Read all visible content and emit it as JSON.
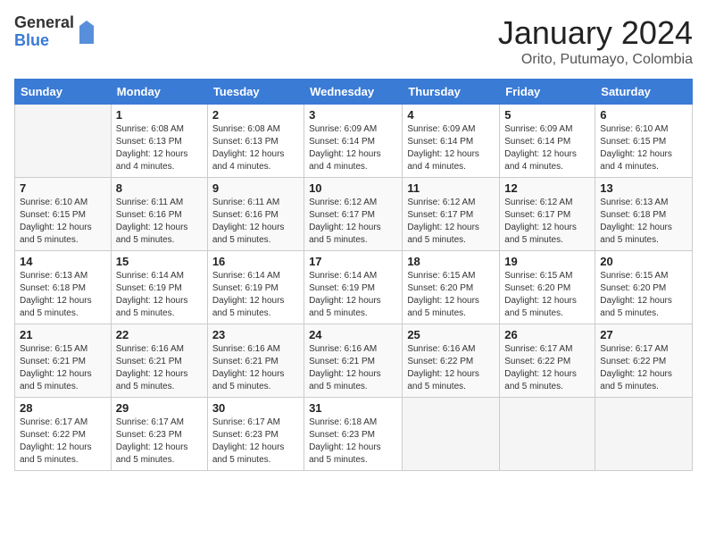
{
  "header": {
    "logo_general": "General",
    "logo_blue": "Blue",
    "month_title": "January 2024",
    "location": "Orito, Putumayo, Colombia"
  },
  "days_of_week": [
    "Sunday",
    "Monday",
    "Tuesday",
    "Wednesday",
    "Thursday",
    "Friday",
    "Saturday"
  ],
  "weeks": [
    [
      {
        "day": "",
        "info": ""
      },
      {
        "day": "1",
        "info": "Sunrise: 6:08 AM\nSunset: 6:13 PM\nDaylight: 12 hours\nand 4 minutes."
      },
      {
        "day": "2",
        "info": "Sunrise: 6:08 AM\nSunset: 6:13 PM\nDaylight: 12 hours\nand 4 minutes."
      },
      {
        "day": "3",
        "info": "Sunrise: 6:09 AM\nSunset: 6:14 PM\nDaylight: 12 hours\nand 4 minutes."
      },
      {
        "day": "4",
        "info": "Sunrise: 6:09 AM\nSunset: 6:14 PM\nDaylight: 12 hours\nand 4 minutes."
      },
      {
        "day": "5",
        "info": "Sunrise: 6:09 AM\nSunset: 6:14 PM\nDaylight: 12 hours\nand 4 minutes."
      },
      {
        "day": "6",
        "info": "Sunrise: 6:10 AM\nSunset: 6:15 PM\nDaylight: 12 hours\nand 4 minutes."
      }
    ],
    [
      {
        "day": "7",
        "info": "Sunrise: 6:10 AM\nSunset: 6:15 PM\nDaylight: 12 hours\nand 5 minutes."
      },
      {
        "day": "8",
        "info": "Sunrise: 6:11 AM\nSunset: 6:16 PM\nDaylight: 12 hours\nand 5 minutes."
      },
      {
        "day": "9",
        "info": "Sunrise: 6:11 AM\nSunset: 6:16 PM\nDaylight: 12 hours\nand 5 minutes."
      },
      {
        "day": "10",
        "info": "Sunrise: 6:12 AM\nSunset: 6:17 PM\nDaylight: 12 hours\nand 5 minutes."
      },
      {
        "day": "11",
        "info": "Sunrise: 6:12 AM\nSunset: 6:17 PM\nDaylight: 12 hours\nand 5 minutes."
      },
      {
        "day": "12",
        "info": "Sunrise: 6:12 AM\nSunset: 6:17 PM\nDaylight: 12 hours\nand 5 minutes."
      },
      {
        "day": "13",
        "info": "Sunrise: 6:13 AM\nSunset: 6:18 PM\nDaylight: 12 hours\nand 5 minutes."
      }
    ],
    [
      {
        "day": "14",
        "info": "Sunrise: 6:13 AM\nSunset: 6:18 PM\nDaylight: 12 hours\nand 5 minutes."
      },
      {
        "day": "15",
        "info": "Sunrise: 6:14 AM\nSunset: 6:19 PM\nDaylight: 12 hours\nand 5 minutes."
      },
      {
        "day": "16",
        "info": "Sunrise: 6:14 AM\nSunset: 6:19 PM\nDaylight: 12 hours\nand 5 minutes."
      },
      {
        "day": "17",
        "info": "Sunrise: 6:14 AM\nSunset: 6:19 PM\nDaylight: 12 hours\nand 5 minutes."
      },
      {
        "day": "18",
        "info": "Sunrise: 6:15 AM\nSunset: 6:20 PM\nDaylight: 12 hours\nand 5 minutes."
      },
      {
        "day": "19",
        "info": "Sunrise: 6:15 AM\nSunset: 6:20 PM\nDaylight: 12 hours\nand 5 minutes."
      },
      {
        "day": "20",
        "info": "Sunrise: 6:15 AM\nSunset: 6:20 PM\nDaylight: 12 hours\nand 5 minutes."
      }
    ],
    [
      {
        "day": "21",
        "info": "Sunrise: 6:15 AM\nSunset: 6:21 PM\nDaylight: 12 hours\nand 5 minutes."
      },
      {
        "day": "22",
        "info": "Sunrise: 6:16 AM\nSunset: 6:21 PM\nDaylight: 12 hours\nand 5 minutes."
      },
      {
        "day": "23",
        "info": "Sunrise: 6:16 AM\nSunset: 6:21 PM\nDaylight: 12 hours\nand 5 minutes."
      },
      {
        "day": "24",
        "info": "Sunrise: 6:16 AM\nSunset: 6:21 PM\nDaylight: 12 hours\nand 5 minutes."
      },
      {
        "day": "25",
        "info": "Sunrise: 6:16 AM\nSunset: 6:22 PM\nDaylight: 12 hours\nand 5 minutes."
      },
      {
        "day": "26",
        "info": "Sunrise: 6:17 AM\nSunset: 6:22 PM\nDaylight: 12 hours\nand 5 minutes."
      },
      {
        "day": "27",
        "info": "Sunrise: 6:17 AM\nSunset: 6:22 PM\nDaylight: 12 hours\nand 5 minutes."
      }
    ],
    [
      {
        "day": "28",
        "info": "Sunrise: 6:17 AM\nSunset: 6:22 PM\nDaylight: 12 hours\nand 5 minutes."
      },
      {
        "day": "29",
        "info": "Sunrise: 6:17 AM\nSunset: 6:23 PM\nDaylight: 12 hours\nand 5 minutes."
      },
      {
        "day": "30",
        "info": "Sunrise: 6:17 AM\nSunset: 6:23 PM\nDaylight: 12 hours\nand 5 minutes."
      },
      {
        "day": "31",
        "info": "Sunrise: 6:18 AM\nSunset: 6:23 PM\nDaylight: 12 hours\nand 5 minutes."
      },
      {
        "day": "",
        "info": ""
      },
      {
        "day": "",
        "info": ""
      },
      {
        "day": "",
        "info": ""
      }
    ]
  ]
}
